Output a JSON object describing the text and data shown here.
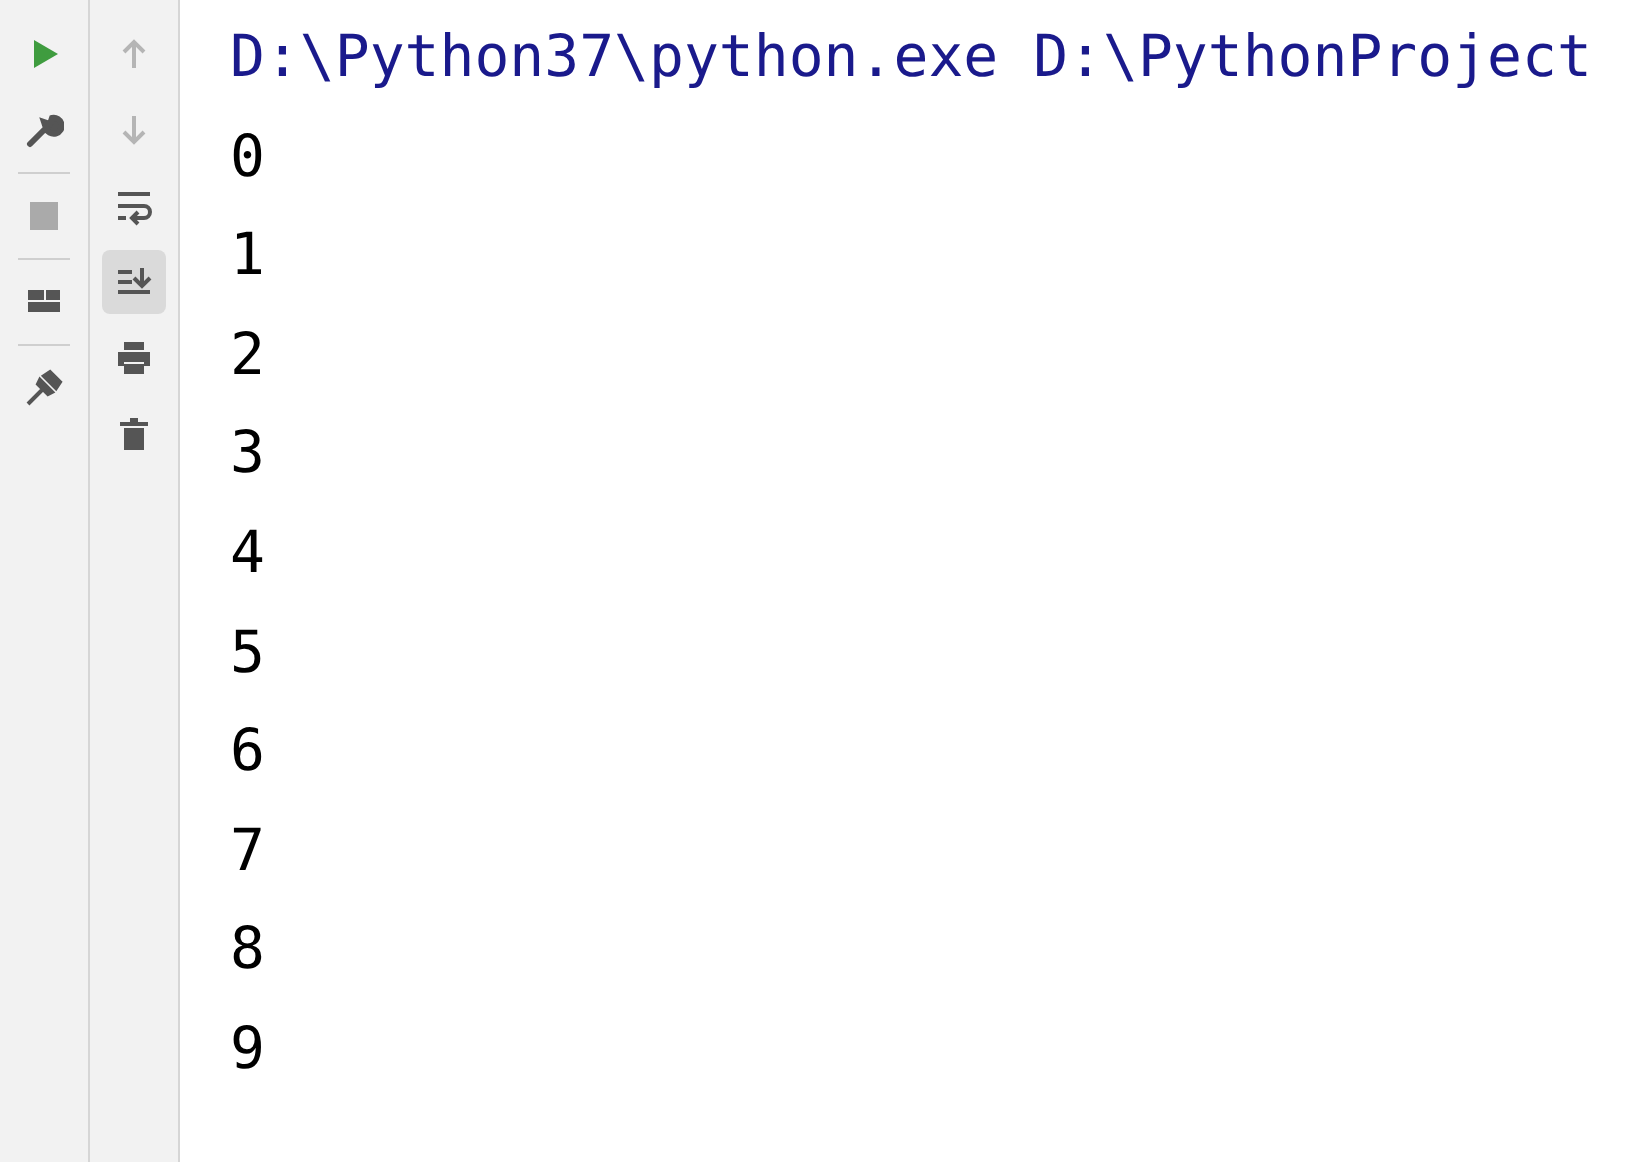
{
  "run_toolbar": [
    {
      "kind": "run",
      "disabled": false
    },
    {
      "kind": "settings",
      "disabled": false
    },
    {
      "kind": "stop",
      "disabled": true
    },
    {
      "kind": "layout",
      "disabled": false
    },
    {
      "kind": "pin",
      "disabled": false
    }
  ],
  "console_toolbar": [
    {
      "kind": "up",
      "disabled": true,
      "selected": false
    },
    {
      "kind": "down",
      "disabled": true,
      "selected": false
    },
    {
      "kind": "wrap",
      "disabled": false,
      "selected": false
    },
    {
      "kind": "scroll-end",
      "disabled": false,
      "selected": true
    },
    {
      "kind": "print",
      "disabled": false,
      "selected": false
    },
    {
      "kind": "trash",
      "disabled": false,
      "selected": false
    }
  ],
  "console": {
    "command": "D:\\Python37\\python.exe D:\\PythonProject",
    "output": [
      "0",
      "1",
      "2",
      "3",
      "4",
      "5",
      "6",
      "7",
      "8",
      "9"
    ]
  }
}
